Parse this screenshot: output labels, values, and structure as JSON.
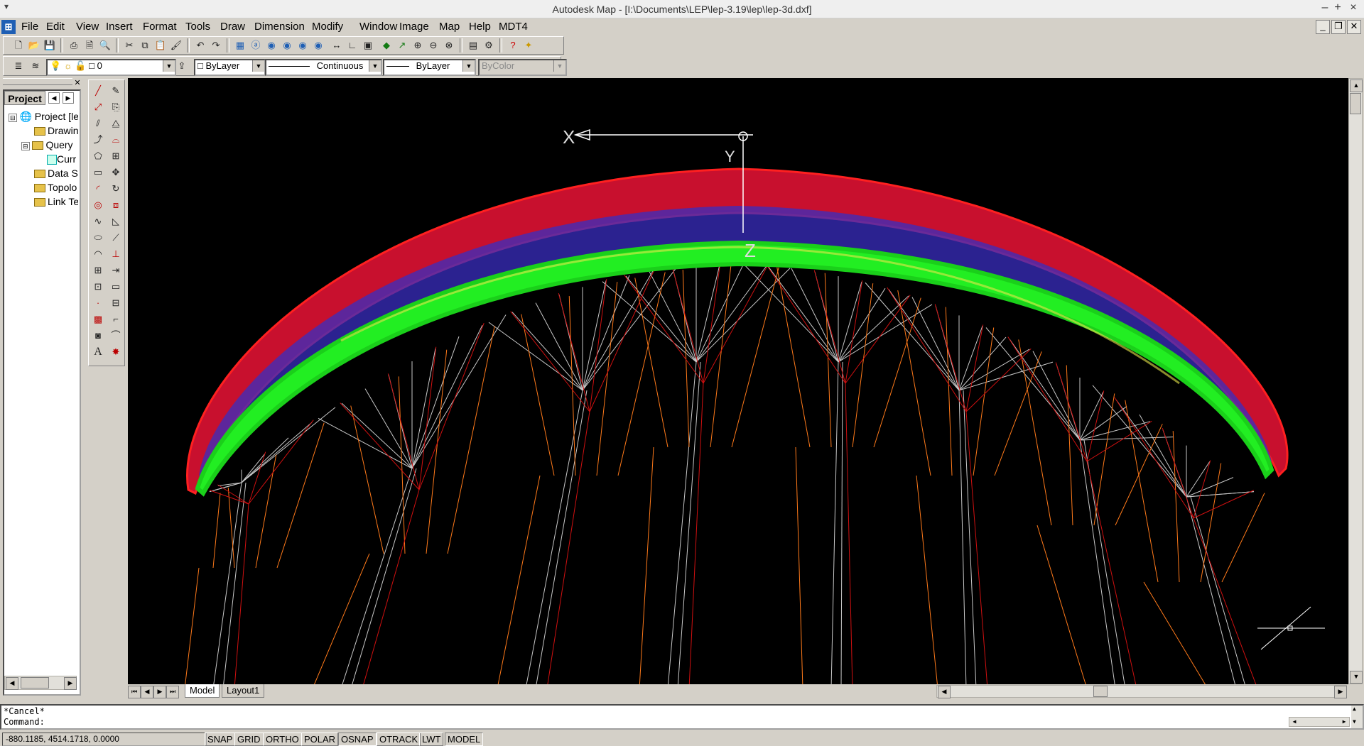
{
  "window": {
    "title": "Autodesk Map - [I:\\Documents\\LEP\\lep-3.19\\lep\\lep-3d.dxf]"
  },
  "menu": [
    "File",
    "Edit",
    "View",
    "Insert",
    "Format",
    "Tools",
    "Draw",
    "Dimension",
    "Modify",
    "Window",
    "Image",
    "Map",
    "Help",
    "MDT4"
  ],
  "layers_toolbar": {
    "layer_value": "0",
    "color_value": "ByLayer",
    "linetype_value": "Continuous",
    "lineweight_value": "ByLayer",
    "plotstyle_value": "ByColor"
  },
  "project_panel": {
    "tab_label": "Project",
    "tree": [
      {
        "label": "Project [le",
        "level": 0
      },
      {
        "label": "Drawin",
        "level": 1
      },
      {
        "label": "Query",
        "level": 1
      },
      {
        "label": "Curr",
        "level": 2
      },
      {
        "label": "Data S",
        "level": 1
      },
      {
        "label": "Topolo",
        "level": 1
      },
      {
        "label": "Link Te",
        "level": 1
      }
    ]
  },
  "ucs": {
    "x_label": "X",
    "y_label": "Y",
    "z_label": "Z"
  },
  "tabs": [
    "Model",
    "Layout1"
  ],
  "command": {
    "line1": "*Cancel*",
    "line2": "Command:"
  },
  "status": {
    "coords": "-880.1185, 4514.1718, 0.0000",
    "buttons": [
      "SNAP",
      "GRID",
      "ORTHO",
      "POLAR",
      "OSNAP",
      "OTRACK",
      "LWT",
      "MODEL"
    ]
  },
  "colors": {
    "canvas": "#000000",
    "canopy_top": "#ff1a1a",
    "canopy_mid": "#3333cc",
    "canopy_bottom": "#22ee22",
    "lines_grey": "#c8c8c8",
    "lines_orange": "#ff7a1a"
  }
}
